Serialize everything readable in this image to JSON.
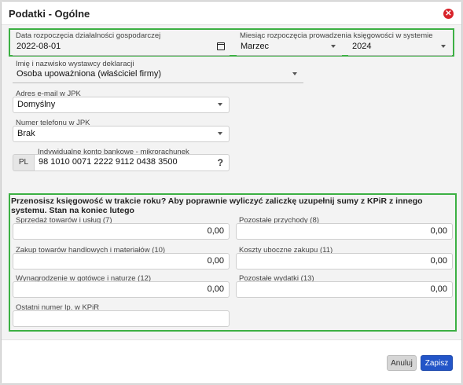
{
  "dialog": {
    "title": "Podatki - Ogólne"
  },
  "start": {
    "date_label": "Data rozpoczęcia działalności gospodarczej",
    "date_value": "2022-08-01",
    "accounting_label": "Miesiąc rozpoczęcia prowadzenia księgowości w systemie",
    "month_value": "Marzec",
    "year_value": "2024"
  },
  "declarant": {
    "label": "Imię i nazwisko wystawcy deklaracji",
    "value": "Osoba upoważniona (właściciel firmy)"
  },
  "email": {
    "label": "Adres e-mail w JPK",
    "value": "Domyślny"
  },
  "phone": {
    "label": "Numer telefonu w JPK",
    "value": "Brak"
  },
  "account": {
    "label": "Indywidualne konto bankowe - mikrorachunek",
    "prefix": "PL",
    "value": "98 1010 0071 2222 9112 0438 3500",
    "help": "?"
  },
  "kpir": {
    "note": "Przenosisz księgowość w trakcie roku? Aby poprawnie wyliczyć zaliczkę uzupełnij sumy z KPiR z innego systemu. Stan na koniec lutego",
    "sprzedaz_label": "Sprzedaż towarów i usług (7)",
    "sprzedaz_value": "0,00",
    "pozostale_przychody_label": "Pozostałe przychody (8)",
    "pozostale_przychody_value": "0,00",
    "zakup_label": "Zakup towarów handlowych i materiałów (10)",
    "zakup_value": "0,00",
    "koszty_label": "Koszty uboczne zakupu (11)",
    "koszty_value": "0,00",
    "wynagrodzenie_label": "Wynagrodzenie w gotówce i naturze (12)",
    "wynagrodzenie_value": "0,00",
    "pozostale_wydatki_label": "Pozostałe wydatki (13)",
    "pozostale_wydatki_value": "0,00",
    "ostatni_label": "Ostatni numer lp. w KPiR",
    "ostatni_value": ""
  },
  "footer": {
    "cancel": "Anuluj",
    "save": "Zapisz"
  },
  "colors": {
    "highlight": "#3cb043",
    "primary": "#2355c8",
    "close": "#d8232a"
  }
}
